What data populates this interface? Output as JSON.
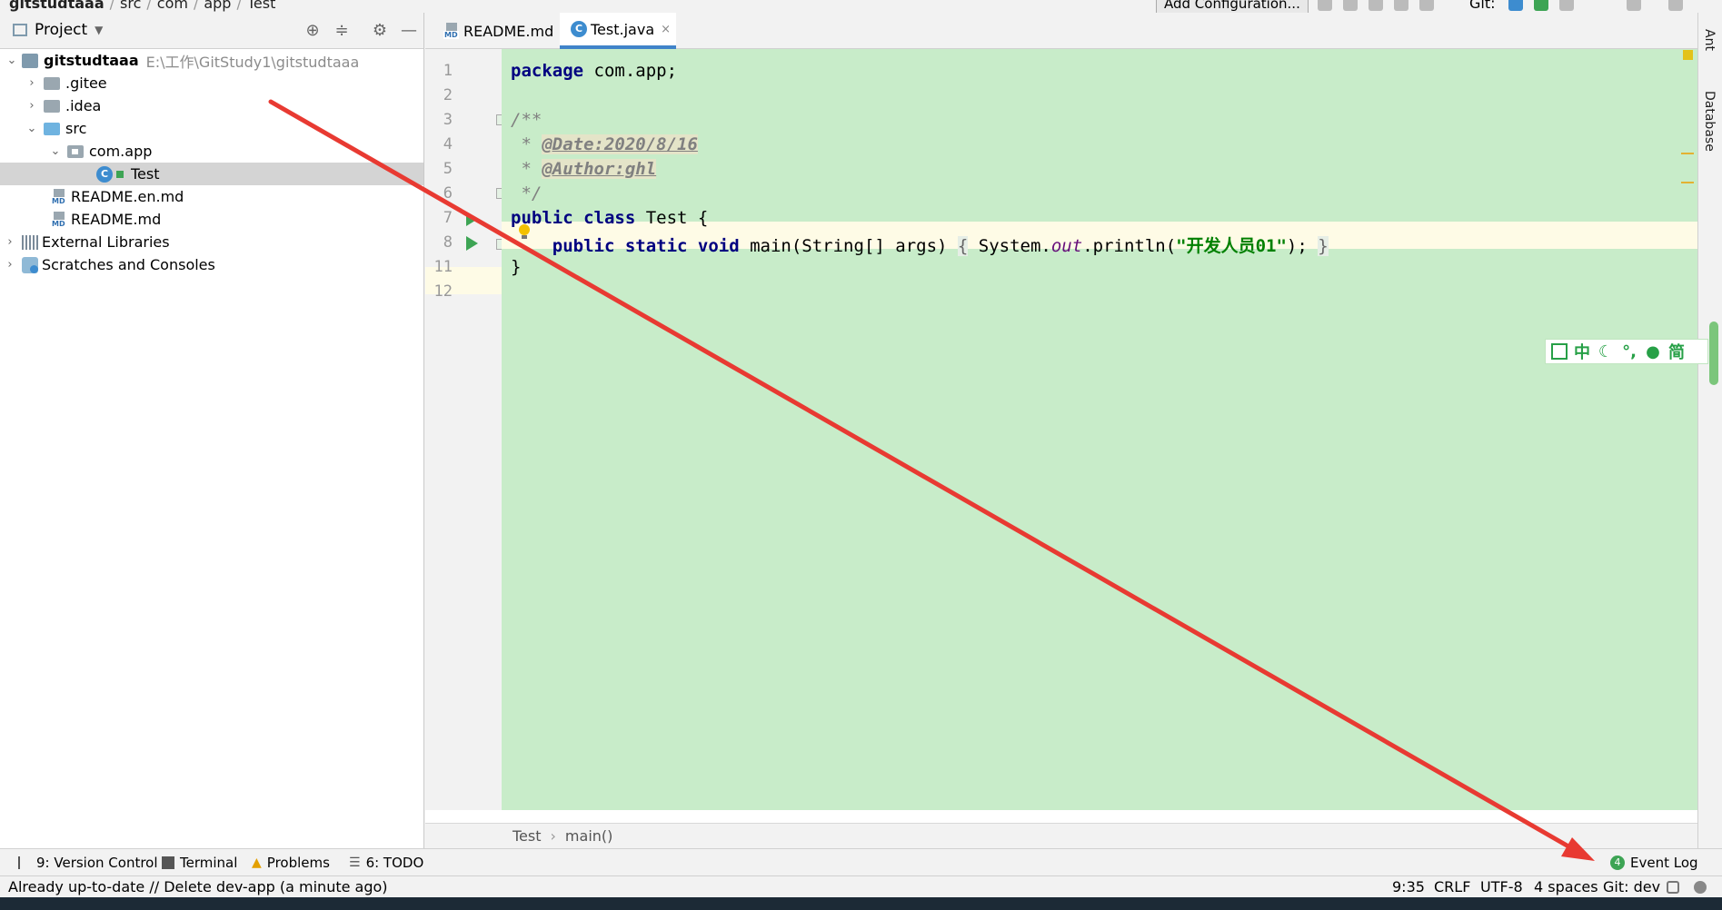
{
  "breadcrumb": [
    "gitstudtaaa",
    "src",
    "com",
    "app",
    "Test"
  ],
  "toolbar": {
    "run_config": "Add Configuration...",
    "git_label": "Git:"
  },
  "project": {
    "title": "Project",
    "tree": [
      {
        "label": "gitstudtaaa",
        "hint": "E:\\工作\\GitStudy1\\gitstudtaaa"
      },
      {
        "label": ".gitee"
      },
      {
        "label": ".idea"
      },
      {
        "label": "src"
      },
      {
        "label": "com.app"
      },
      {
        "label": "Test"
      },
      {
        "label": "README.en.md"
      },
      {
        "label": "README.md"
      },
      {
        "label": "External Libraries"
      },
      {
        "label": "Scratches and Consoles"
      }
    ]
  },
  "editor": {
    "tabs": [
      {
        "label": "README.md",
        "close": "×"
      },
      {
        "label": "Test.java",
        "close": "×"
      }
    ],
    "line_numbers": [
      "1",
      "2",
      "3",
      "4",
      "5",
      "6",
      "7",
      "8",
      "11",
      "12"
    ],
    "code": {
      "l1_kw": "package",
      "l1_rest": " com.app;",
      "l3": "/**",
      "l4_star": " * ",
      "l4_tag": "@Date:2020/8/16",
      "l5_star": " * ",
      "l5_tag": "@Author:ghl",
      "l6": " */",
      "l7_kw": "public class",
      "l7_rest": " Test {",
      "l8_indent": "    ",
      "l8_kw": "public static void",
      "l8_mid": " main(String[] args) ",
      "l8_brace_open": "{",
      "l8_sys": " System.",
      "l8_field": "out",
      "l8_call": ".println(",
      "l8_str": "\"开发人员01\"",
      "l8_end": "); ",
      "l8_brace_close": "}",
      "l11": "}"
    },
    "crumbs": [
      "Test",
      "main()"
    ],
    "crumb_sep": "›"
  },
  "right_strip": [
    "Ant",
    "Database"
  ],
  "ime": [
    "中",
    "简"
  ],
  "tool_windows": {
    "version_control": "9: Version Control",
    "terminal": "Terminal",
    "problems": "Problems",
    "todo": "6: TODO",
    "event_log_count": "4",
    "event_log": "Event Log"
  },
  "status": {
    "message": "Already up-to-date // Delete dev-app (a minute ago)",
    "position": "9:35",
    "line_sep": "CRLF",
    "encoding": "UTF-8",
    "indent": "4 spaces",
    "branch": "Git: dev"
  },
  "colors": {
    "code_bg": "#c8ecc9",
    "accent": "#4083c9",
    "annotation_arrow": "#e83a32"
  }
}
